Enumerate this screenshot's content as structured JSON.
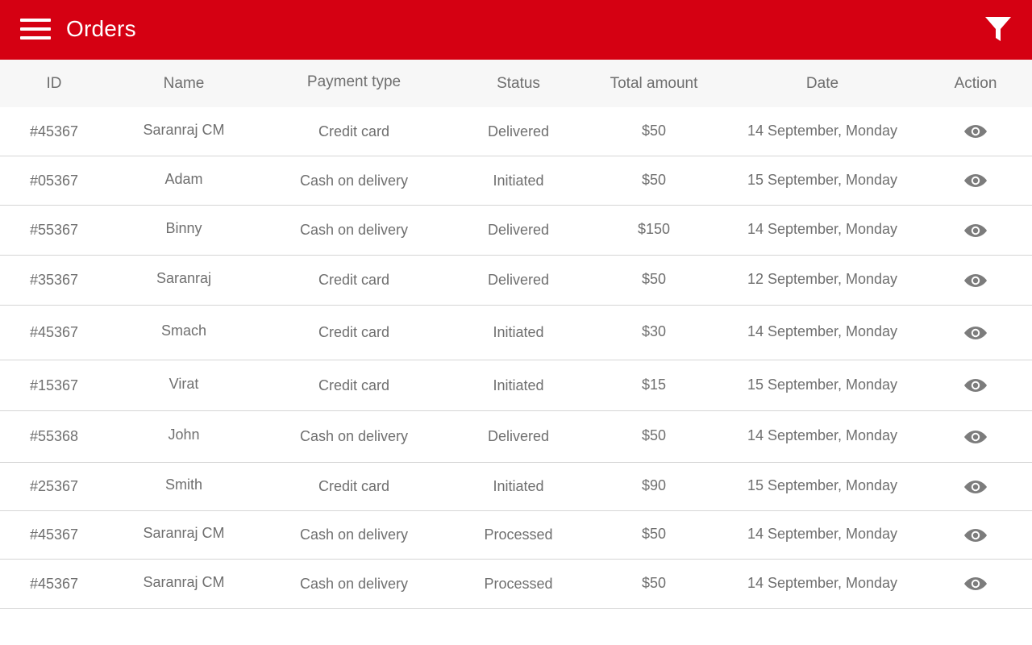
{
  "appbar": {
    "title": "Orders",
    "menu_icon": "menu-icon",
    "filter_icon": "filter-icon",
    "color": "#d50012"
  },
  "table": {
    "headers": {
      "id": "ID",
      "name": "Name",
      "payment_type": "Payment type",
      "status": "Status",
      "total_amount": "Total amount",
      "date": "Date",
      "action": "Action"
    },
    "rows": [
      {
        "id": "#45367",
        "name": "Saranraj CM",
        "payment_type": "Credit card",
        "status": "Delivered",
        "total_amount": "$50",
        "date": "14 September, Monday"
      },
      {
        "id": "#05367",
        "name": "Adam",
        "payment_type": "Cash on delivery",
        "status": "Initiated",
        "total_amount": "$50",
        "date": "15 September, Monday"
      },
      {
        "id": "#55367",
        "name": "Binny",
        "payment_type": "Cash on delivery",
        "status": "Delivered",
        "total_amount": "$150",
        "date": "14 September, Monday"
      },
      {
        "id": "#35367",
        "name": "Saranraj",
        "payment_type": "Credit card",
        "status": "Delivered",
        "total_amount": "$50",
        "date": "12 September, Monday"
      },
      {
        "id": "#45367",
        "name": "Smach",
        "payment_type": "Credit card",
        "status": "Initiated",
        "total_amount": "$30",
        "date": "14 September, Monday"
      },
      {
        "id": "#15367",
        "name": "Virat",
        "payment_type": "Credit card",
        "status": "Initiated",
        "total_amount": "$15",
        "date": "15 September, Monday"
      },
      {
        "id": "#55368",
        "name": "John",
        "payment_type": "Cash on delivery",
        "status": "Delivered",
        "total_amount": "$50",
        "date": "14 September, Monday"
      },
      {
        "id": "#25367",
        "name": "Smith",
        "payment_type": "Credit card",
        "status": "Initiated",
        "total_amount": "$90",
        "date": "15 September, Monday"
      },
      {
        "id": "#45367",
        "name": "Saranraj CM",
        "payment_type": "Cash on delivery",
        "status": "Processed",
        "total_amount": "$50",
        "date": "14 September, Monday"
      },
      {
        "id": "#45367",
        "name": "Saranraj CM",
        "payment_type": "Cash on delivery",
        "status": "Processed",
        "total_amount": "$50",
        "date": "14 September, Monday"
      }
    ],
    "action_icon": "eye-icon"
  }
}
